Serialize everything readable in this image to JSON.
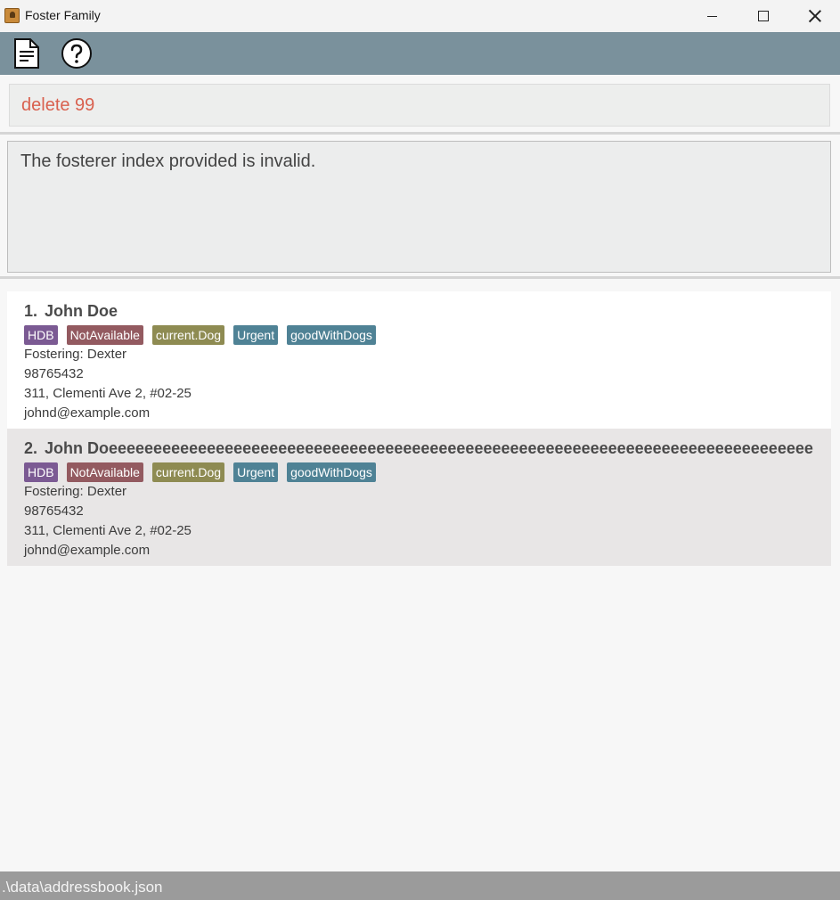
{
  "window": {
    "title": "Foster Family"
  },
  "command": {
    "text": "delete 99"
  },
  "result": {
    "text": "The fosterer index provided is invalid."
  },
  "colors": {
    "menubar": "#7a919c",
    "command_text": "#d9614f",
    "tag_hdb": "#7b5a93",
    "tag_availability": "#935a60",
    "tag_animal": "#8e8b52",
    "tag_urgent": "#4f8295",
    "tag_goodwithdogs": "#4f8295"
  },
  "persons": [
    {
      "index": "1.",
      "name": "John Doe",
      "tags": [
        "HDB",
        "NotAvailable",
        "current.Dog",
        "Urgent",
        "goodWithDogs"
      ],
      "fostering": "Fostering: Dexter",
      "phone": "98765432",
      "address": "311, Clementi Ave 2, #02-25",
      "email": "johnd@example.com"
    },
    {
      "index": "2.",
      "name": "John Doeeeeeeeeeeeeeeeeeeeeeeeeeeeeeeeeeeeeeeeeeeeeeeeeeeeeeeeeeeeeeeeeeeeeeeeeeeeeeee",
      "tags": [
        "HDB",
        "NotAvailable",
        "current.Dog",
        "Urgent",
        "goodWithDogs"
      ],
      "fostering": "Fostering: Dexter",
      "phone": "98765432",
      "address": "311, Clementi Ave 2, #02-25",
      "email": "johnd@example.com"
    }
  ],
  "status": {
    "path": ".\\data\\addressbook.json"
  }
}
